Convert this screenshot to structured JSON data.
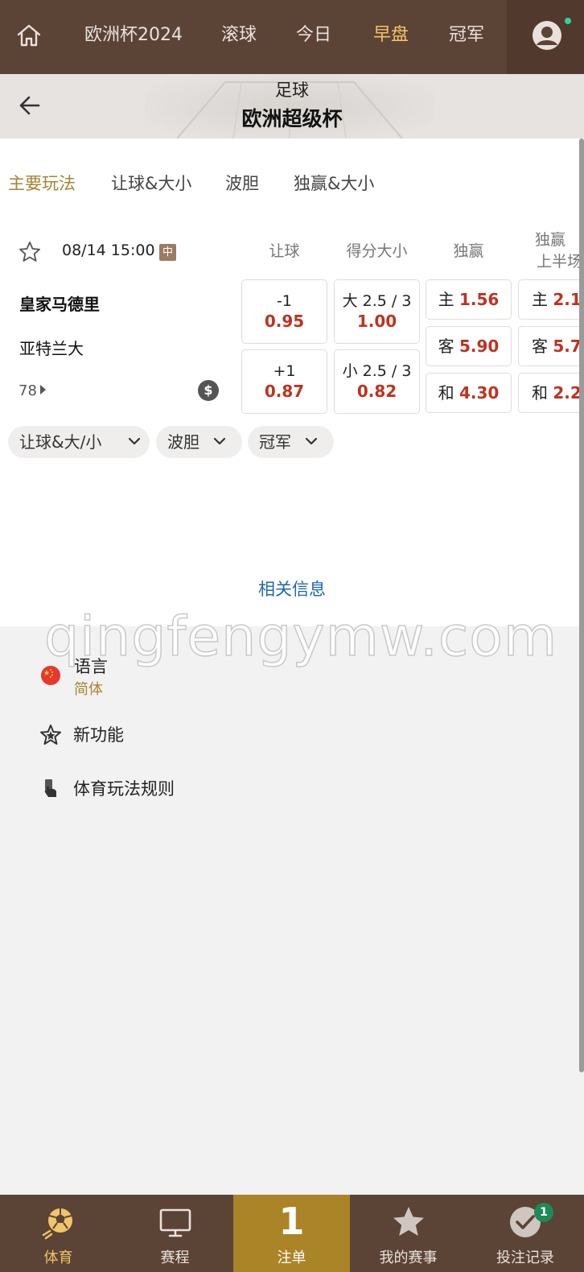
{
  "topnav": {
    "tabs": [
      {
        "label": "欧洲杯2024"
      },
      {
        "label": "滚球"
      },
      {
        "label": "今日"
      },
      {
        "label": "早盘",
        "active": true
      },
      {
        "label": "冠军"
      }
    ],
    "icons": [
      "home-icon",
      "user-icon"
    ],
    "accent": "#f0c46a",
    "bg": "#5b4336"
  },
  "header": {
    "sport": "足球",
    "league": "欧洲超级杯"
  },
  "market_tabs": [
    {
      "label": "主要玩法",
      "active": true
    },
    {
      "label": "让球&大小"
    },
    {
      "label": "波胆"
    },
    {
      "label": "独赢&大小"
    }
  ],
  "match": {
    "datetime": "08/14 15:00",
    "live_tag": "中",
    "home": "皇家马德里",
    "away": "亚特兰大",
    "more_count": "78",
    "cash_symbol": "$",
    "columns": [
      "让球",
      "得分大小",
      "独赢",
      "独赢",
      "上半场"
    ],
    "handicap": [
      {
        "line": "-1",
        "odds": "0.95"
      },
      {
        "line": "+1",
        "odds": "0.87"
      }
    ],
    "totals": [
      {
        "line": "大 2.5 / 3",
        "odds": "1.00"
      },
      {
        "line": "小 2.5 / 3",
        "odds": "0.82"
      }
    ],
    "moneyline": [
      {
        "label": "主",
        "odds": "1.56"
      },
      {
        "label": "客",
        "odds": "5.90"
      },
      {
        "label": "和",
        "odds": "4.30"
      }
    ],
    "first_half": [
      {
        "label": "主",
        "odds": "2.1"
      },
      {
        "label": "客",
        "odds": "5.7"
      },
      {
        "label": "和",
        "odds": "2.2"
      }
    ],
    "odds_color": "#c0321e"
  },
  "chips": [
    {
      "label": "让球&大/小"
    },
    {
      "label": "波胆"
    },
    {
      "label": "冠军"
    }
  ],
  "related": "相关信息",
  "watermark": "qingfengymw.com",
  "settings": {
    "language": {
      "label": "语言",
      "value": "简体"
    },
    "new_features": {
      "label": "新功能"
    },
    "rules": {
      "label": "体育玩法规则"
    }
  },
  "bottombar": {
    "items": [
      {
        "label": "体育",
        "active": true
      },
      {
        "label": "赛程"
      },
      {
        "label": "注单",
        "count": "1"
      },
      {
        "label": "我的赛事"
      },
      {
        "label": "投注记录",
        "badge": "1"
      }
    ],
    "slip_color": "#ab8428"
  }
}
